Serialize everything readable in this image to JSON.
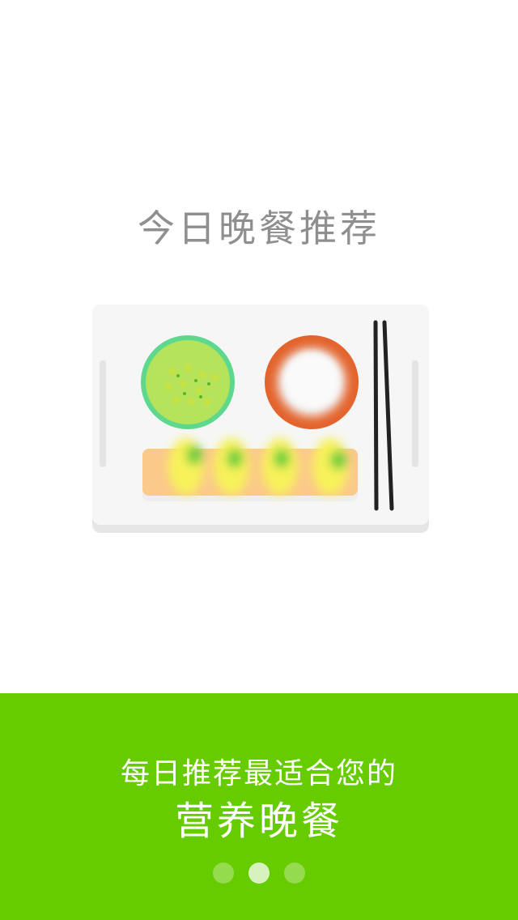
{
  "header": {
    "title": "今日晚餐推荐"
  },
  "illustration": {
    "name": "dinner-tray-illustration",
    "colors": {
      "tray": "#f6f6f6",
      "tray_shadow": "#e8e8e8",
      "soup_bowl_rim": "#5ed88c",
      "soup": "#b6e35c",
      "rice_bowl": "#e3632c",
      "rice": "#f5f5f5",
      "sushi_board": "#fbc98a",
      "sushi": "#f7f25a",
      "chopsticks": "#222222"
    }
  },
  "footer": {
    "subtitle": "每日推荐最适合您的",
    "headline": "营养晚餐",
    "background": "#66cc00",
    "pagination": {
      "count": 3,
      "active_index": 1
    }
  }
}
